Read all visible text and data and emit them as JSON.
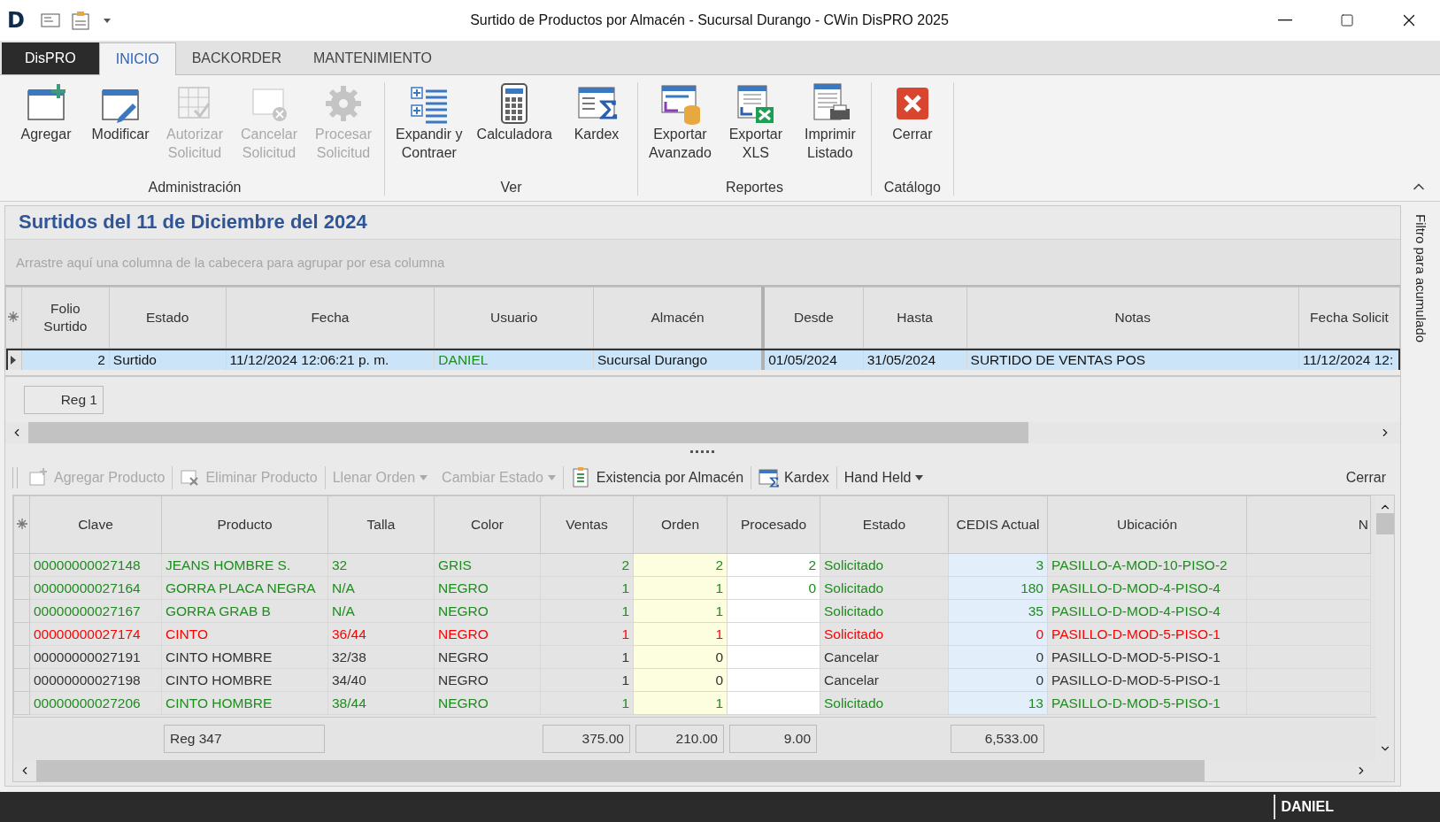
{
  "window": {
    "logo": "D",
    "title": "Surtido de Productos por Almacén - Sucursal Durango - CWin DisPRO 2025"
  },
  "tabs": [
    {
      "label": "DisPRO",
      "kind": "app",
      "selected": false
    },
    {
      "label": "INICIO",
      "kind": "tab",
      "selected": true
    },
    {
      "label": "BACKORDER",
      "kind": "tab",
      "selected": false
    },
    {
      "label": "MANTENIMIENTO",
      "kind": "tab",
      "selected": false
    }
  ],
  "ribbon": [
    {
      "name": "Administración",
      "items": [
        {
          "label": "Agregar",
          "disabled": false
        },
        {
          "label": "Modificar",
          "disabled": false
        },
        {
          "label": "Autorizar\nSolicitud",
          "disabled": true
        },
        {
          "label": "Cancelar\nSolicitud",
          "disabled": true
        },
        {
          "label": "Procesar\nSolicitud",
          "disabled": true
        }
      ]
    },
    {
      "name": "Ver",
      "items": [
        {
          "label": "Expandir y\nContraer",
          "disabled": false
        },
        {
          "label": "Calculadora",
          "disabled": false
        },
        {
          "label": "Kardex",
          "disabled": false
        }
      ]
    },
    {
      "name": "Reportes",
      "items": [
        {
          "label": "Exportar\nAvanzado",
          "disabled": false
        },
        {
          "label": "Exportar\nXLS",
          "disabled": false
        },
        {
          "label": "Imprimir\nListado",
          "disabled": false
        }
      ]
    },
    {
      "name": "Catálogo",
      "items": [
        {
          "label": "Cerrar",
          "disabled": false
        }
      ]
    }
  ],
  "header": {
    "title": "Surtidos del 11 de Diciembre del 2024",
    "group_hint": "Arrastre aquí una columna de la cabecera para agrupar por esa columna"
  },
  "orders": {
    "columns": [
      "Folio\nSurtido",
      "Estado",
      "Fecha",
      "Usuario",
      "Almacén",
      "Desde",
      "Hasta",
      "Notas",
      "Fecha Solicit"
    ],
    "rows": [
      {
        "selected": true,
        "cells": [
          "2",
          "Surtido",
          "11/12/2024 12:06:21 p. m.",
          "DANIEL",
          "Sucursal Durango",
          "01/05/2024",
          "31/05/2024",
          "SURTIDO DE VENTAS POS",
          "11/12/2024 12:"
        ]
      }
    ],
    "footer": "Reg 1"
  },
  "side_panel": "Filtro para acumulado",
  "toolbar": [
    {
      "label": "Agregar Producto",
      "disabled": true,
      "dropdown": false,
      "divider_before": false
    },
    {
      "label": "Eliminar Producto",
      "disabled": true,
      "dropdown": false,
      "divider_before": true
    },
    {
      "label": "Llenar Orden",
      "disabled": true,
      "dropdown": true,
      "divider_before": true
    },
    {
      "label": "Cambiar Estado",
      "disabled": true,
      "dropdown": true,
      "divider_before": false
    },
    {
      "label": "Existencia por Almacén",
      "disabled": false,
      "dropdown": false,
      "divider_before": true
    },
    {
      "label": "Kardex",
      "disabled": false,
      "dropdown": false,
      "divider_before": true
    },
    {
      "label": "Hand Held",
      "disabled": false,
      "dropdown": true,
      "divider_before": true
    }
  ],
  "toolbar_close": "Cerrar",
  "products": {
    "columns": [
      "Clave",
      "Producto",
      "Talla",
      "Color",
      "Ventas",
      "Orden",
      "Procesado",
      "Estado",
      "CEDIS Actual",
      "Ubicación",
      "N"
    ],
    "rows": [
      {
        "color": "#1e8c1e",
        "clave": "00000000027148",
        "producto": "JEANS HOMBRE S.",
        "talla": "32",
        "color_label": "GRIS",
        "ventas": "2",
        "orden": "2",
        "procesado": "2",
        "estado": "Solicitado",
        "cedis_actual": "3",
        "ubicacion": "PASILLO-A-MOD-10-PISO-2"
      },
      {
        "color": "#1e8c1e",
        "clave": "00000000027164",
        "producto": "GORRA PLACA NEGRA",
        "talla": "N/A",
        "color_label": "NEGRO",
        "ventas": "1",
        "orden": "1",
        "procesado": "0",
        "estado": "Solicitado",
        "cedis_actual": "180",
        "ubicacion": "PASILLO-D-MOD-4-PISO-4"
      },
      {
        "color": "#1e8c1e",
        "clave": "00000000027167",
        "producto": "GORRA GRAB B",
        "talla": "N/A",
        "color_label": "NEGRO",
        "ventas": "1",
        "orden": "1",
        "estado": "Solicitado",
        "cedis_actual": "35",
        "ubicacion": "PASILLO-D-MOD-4-PISO-4"
      },
      {
        "color": "#ff0000",
        "clave": "00000000027174",
        "producto": "CINTO",
        "talla": "36/44",
        "color_label": "NEGRO",
        "ventas": "1",
        "orden": "1",
        "estado": "Solicitado",
        "cedis_actual": "0",
        "ubicacion": "PASILLO-D-MOD-5-PISO-1"
      },
      {
        "color": "#333333",
        "clave": "00000000027191",
        "producto": "CINTO HOMBRE",
        "talla": "32/38",
        "color_label": "NEGRO",
        "ventas": "1",
        "orden": "0",
        "estado": "Cancelar",
        "cedis_actual": "0",
        "ubicacion": "PASILLO-D-MOD-5-PISO-1"
      },
      {
        "color": "#333333",
        "clave": "00000000027198",
        "producto": "CINTO HOMBRE",
        "talla": "34/40",
        "color_label": "NEGRO",
        "ventas": "1",
        "orden": "0",
        "estado": "Cancelar",
        "cedis_actual": "0",
        "ubicacion": "PASILLO-D-MOD-5-PISO-1"
      },
      {
        "color": "#1e8c1e",
        "clave": "00000000027206",
        "producto": "CINTO HOMBRE",
        "talla": "38/44",
        "color_label": "NEGRO",
        "ventas": "1",
        "orden": "1",
        "estado": "Solicitado",
        "cedis_actual": "13",
        "ubicacion": "PASILLO-D-MOD-5-PISO-1"
      }
    ],
    "footer": {
      "producto": "Reg 347",
      "ventas": "375.00",
      "orden": "210.00",
      "procesado": "9.00",
      "cedis_actual": "6,533.00"
    }
  },
  "status_bar": {
    "user": "DANIEL"
  }
}
